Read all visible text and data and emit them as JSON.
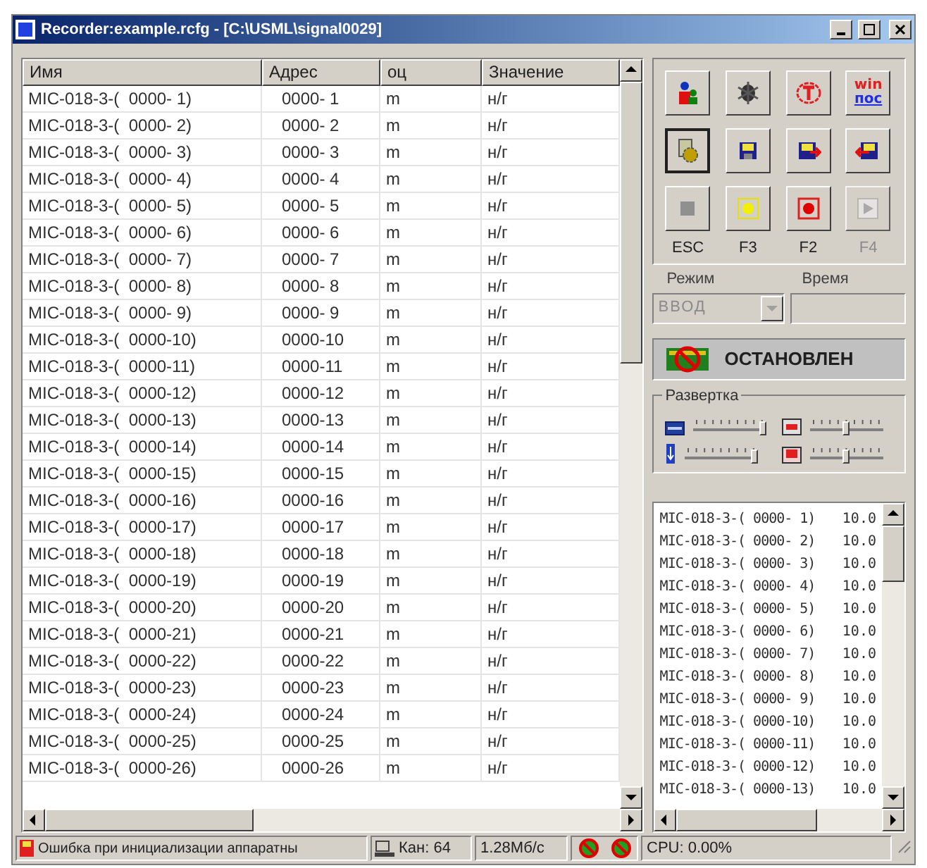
{
  "window": {
    "title": "Recorder:example.rcfg - [C:\\USML\\signal0029]"
  },
  "table": {
    "columns": [
      "Имя",
      "Адрес",
      "оц",
      "Значение"
    ],
    "rows": [
      {
        "name": "MIC-018-3-(  0000- 1)",
        "address": "0000- 1",
        "unit": "m",
        "value": "н/г"
      },
      {
        "name": "MIC-018-3-(  0000- 2)",
        "address": "0000- 2",
        "unit": "m",
        "value": "н/г"
      },
      {
        "name": "MIC-018-3-(  0000- 3)",
        "address": "0000- 3",
        "unit": "m",
        "value": "н/г"
      },
      {
        "name": "MIC-018-3-(  0000- 4)",
        "address": "0000- 4",
        "unit": "m",
        "value": "н/г"
      },
      {
        "name": "MIC-018-3-(  0000- 5)",
        "address": "0000- 5",
        "unit": "m",
        "value": "н/г"
      },
      {
        "name": "MIC-018-3-(  0000- 6)",
        "address": "0000- 6",
        "unit": "m",
        "value": "н/г"
      },
      {
        "name": "MIC-018-3-(  0000- 7)",
        "address": "0000- 7",
        "unit": "m",
        "value": "н/г"
      },
      {
        "name": "MIC-018-3-(  0000- 8)",
        "address": "0000- 8",
        "unit": "m",
        "value": "н/г"
      },
      {
        "name": "MIC-018-3-(  0000- 9)",
        "address": "0000- 9",
        "unit": "m",
        "value": "н/г"
      },
      {
        "name": "MIC-018-3-(  0000-10)",
        "address": "0000-10",
        "unit": "m",
        "value": "н/г"
      },
      {
        "name": "MIC-018-3-(  0000-11)",
        "address": "0000-11",
        "unit": "m",
        "value": "н/г"
      },
      {
        "name": "MIC-018-3-(  0000-12)",
        "address": "0000-12",
        "unit": "m",
        "value": "н/г"
      },
      {
        "name": "MIC-018-3-(  0000-13)",
        "address": "0000-13",
        "unit": "m",
        "value": "н/г"
      },
      {
        "name": "MIC-018-3-(  0000-14)",
        "address": "0000-14",
        "unit": "m",
        "value": "н/г"
      },
      {
        "name": "MIC-018-3-(  0000-15)",
        "address": "0000-15",
        "unit": "m",
        "value": "н/г"
      },
      {
        "name": "MIC-018-3-(  0000-16)",
        "address": "0000-16",
        "unit": "m",
        "value": "н/г"
      },
      {
        "name": "MIC-018-3-(  0000-17)",
        "address": "0000-17",
        "unit": "m",
        "value": "н/г"
      },
      {
        "name": "MIC-018-3-(  0000-18)",
        "address": "0000-18",
        "unit": "m",
        "value": "н/г"
      },
      {
        "name": "MIC-018-3-(  0000-19)",
        "address": "0000-19",
        "unit": "m",
        "value": "н/г"
      },
      {
        "name": "MIC-018-3-(  0000-20)",
        "address": "0000-20",
        "unit": "m",
        "value": "н/г"
      },
      {
        "name": "MIC-018-3-(  0000-21)",
        "address": "0000-21",
        "unit": "m",
        "value": "н/г"
      },
      {
        "name": "MIC-018-3-(  0000-22)",
        "address": "0000-22",
        "unit": "m",
        "value": "н/г"
      },
      {
        "name": "MIC-018-3-(  0000-23)",
        "address": "0000-23",
        "unit": "m",
        "value": "н/г"
      },
      {
        "name": "MIC-018-3-(  0000-24)",
        "address": "0000-24",
        "unit": "m",
        "value": "н/г"
      },
      {
        "name": "MIC-018-3-(  0000-25)",
        "address": "0000-25",
        "unit": "m",
        "value": "н/г"
      },
      {
        "name": "MIC-018-3-(  0000-26)",
        "address": "0000-26",
        "unit": "m",
        "value": "н/г"
      }
    ]
  },
  "tool_buttons": [
    {
      "kind": "figures",
      "pressed": false
    },
    {
      "kind": "bug",
      "pressed": false
    },
    {
      "kind": "circled-t",
      "pressed": false
    },
    {
      "kind": "text",
      "pressed": false,
      "text_top": "win",
      "text_bottom": "пос"
    },
    {
      "kind": "gear-document",
      "pressed": true
    },
    {
      "kind": "floppy",
      "pressed": false
    },
    {
      "kind": "floppy-import",
      "pressed": false
    },
    {
      "kind": "floppy-export",
      "pressed": false
    },
    {
      "kind": "stop",
      "pressed": false
    },
    {
      "kind": "yellow-dot",
      "pressed": false
    },
    {
      "kind": "record",
      "pressed": false
    },
    {
      "kind": "play",
      "pressed": false,
      "disabled": true
    }
  ],
  "key_labels": [
    {
      "text": "ESC",
      "disabled": false
    },
    {
      "text": "F3",
      "disabled": false
    },
    {
      "text": "F2",
      "disabled": false
    },
    {
      "text": "F4",
      "disabled": true
    }
  ],
  "mode": {
    "label": "Режим",
    "value": "ВВОД",
    "disabled": true
  },
  "time": {
    "label": "Время"
  },
  "status_button": {
    "label": "ОСТАНОВЛЕН"
  },
  "sweep": {
    "label": "Развертка",
    "sliders": [
      {
        "kind": "screen",
        "level": 0.95
      },
      {
        "kind": "arrow",
        "level": 0.95
      },
      {
        "kind": "card",
        "level": 0.5
      },
      {
        "kind": "card-red",
        "level": 0.5
      }
    ]
  },
  "channel_list": [
    {
      "name": "MIC-018-3-( 0000- 1)",
      "value": "10.0"
    },
    {
      "name": "MIC-018-3-( 0000- 2)",
      "value": "10.0"
    },
    {
      "name": "MIC-018-3-( 0000- 3)",
      "value": "10.0"
    },
    {
      "name": "MIC-018-3-( 0000- 4)",
      "value": "10.0"
    },
    {
      "name": "MIC-018-3-( 0000- 5)",
      "value": "10.0"
    },
    {
      "name": "MIC-018-3-( 0000- 6)",
      "value": "10.0"
    },
    {
      "name": "MIC-018-3-( 0000- 7)",
      "value": "10.0"
    },
    {
      "name": "MIC-018-3-( 0000- 8)",
      "value": "10.0"
    },
    {
      "name": "MIC-018-3-( 0000- 9)",
      "value": "10.0"
    },
    {
      "name": "MIC-018-3-( 0000-10)",
      "value": "10.0"
    },
    {
      "name": "MIC-018-3-( 0000-11)",
      "value": "10.0"
    },
    {
      "name": "MIC-018-3-( 0000-12)",
      "value": "10.0"
    },
    {
      "name": "MIC-018-3-( 0000-13)",
      "value": "10.0"
    }
  ],
  "status_bar": {
    "message": "Ошибка при инициализации аппаратны",
    "channels": "Кан: 64",
    "rate": "1.28Мб/с",
    "cpu": "CPU: 0.00%"
  }
}
